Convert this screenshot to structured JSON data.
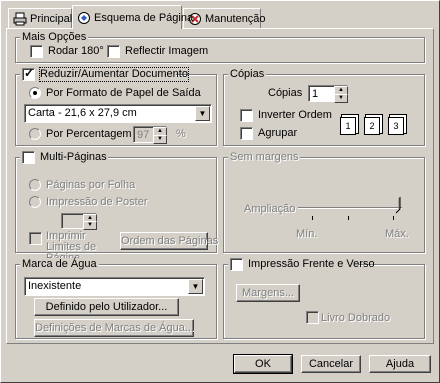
{
  "tabs": [
    {
      "label": "Principal",
      "icon": "printer-icon"
    },
    {
      "label": "Esquema de Página",
      "icon": "layout-icon"
    },
    {
      "label": "Manutenção",
      "icon": "maintenance-icon"
    }
  ],
  "mais_opcoes": {
    "title": "Mais Opções",
    "rodar": "Rodar 180°",
    "reflectir": "Reflectir Imagem"
  },
  "reduzir": {
    "title": "Reduzir/Aumentar Documento",
    "por_formato": "Por Formato de Papel de Saída",
    "paper_value": "Carta - 21,6 x 27,9 cm",
    "por_percentagem": "Por Percentagem",
    "percent_value": "97",
    "percent_sign": "%"
  },
  "copias": {
    "title": "Cópias",
    "label": "Cópias",
    "value": "1",
    "inverter": "Inverter Ordem",
    "agrupar": "Agrupar",
    "page_numbers": [
      "1",
      "2",
      "3"
    ]
  },
  "multi": {
    "title": "Multi-Páginas",
    "paginas_por_folha": "Páginas por Folha",
    "impressao_poster": "Impressão de Poster",
    "imprimir_limites": "Imprimir Limites de Página",
    "ordem_button": "Ordem das Páginas"
  },
  "sem_margens": {
    "title": "Sem margens",
    "ampliacao": "Ampliação",
    "min": "Mín.",
    "max": "Máx."
  },
  "marca": {
    "title": "Marca de Água",
    "value": "Inexistente",
    "definido_button": "Definido pelo Utilizador...",
    "definicoes_button": "Definições de Marcas de Água..."
  },
  "frente_verso": {
    "title": "Impressão Frente e Verso",
    "margens_button": "Margens...",
    "livro": "Livro Dobrado"
  },
  "footer": {
    "ok": "OK",
    "cancelar": "Cancelar",
    "ajuda": "Ajuda"
  }
}
